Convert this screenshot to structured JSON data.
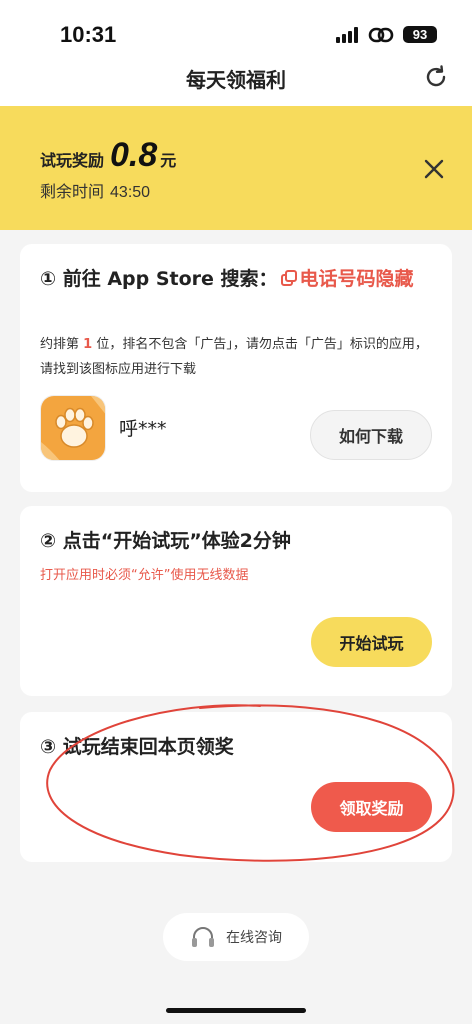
{
  "status": {
    "time": "10:31",
    "battery": "93"
  },
  "nav": {
    "title": "每天领福利",
    "refresh_icon": "refresh-icon"
  },
  "banner": {
    "reward_label": "试玩奖励",
    "reward_amount": "0.8",
    "reward_unit": "元",
    "remain_label": "剩余时间",
    "remain_value": "43:50",
    "close_icon": "close-icon",
    "background": "#f7db5c"
  },
  "step1": {
    "title_prefix": "① 前往 App Store 搜索：",
    "keyword": "电话号码隐藏",
    "desc_a": "约排第 ",
    "rank": "1",
    "desc_b": " 位，排名不包含「广告」，请勿点击「广告」标识的应用，请找到该图标应用进行下载",
    "app_name": "呼***",
    "button": "如何下载"
  },
  "step2": {
    "title": "② 点击“开始试玩”体验2分钟",
    "warning": "打开应用时必须“允许”使用无线数据",
    "button": "开始试玩"
  },
  "step3": {
    "title": "③ 试玩结束回本页领奖",
    "button": "领取奖励"
  },
  "consult": {
    "label": "在线咨询",
    "icon": "headset-icon"
  },
  "colors": {
    "accent_yellow": "#f7db5c",
    "accent_red": "#ef5a4c",
    "link_red": "#e8594b"
  }
}
